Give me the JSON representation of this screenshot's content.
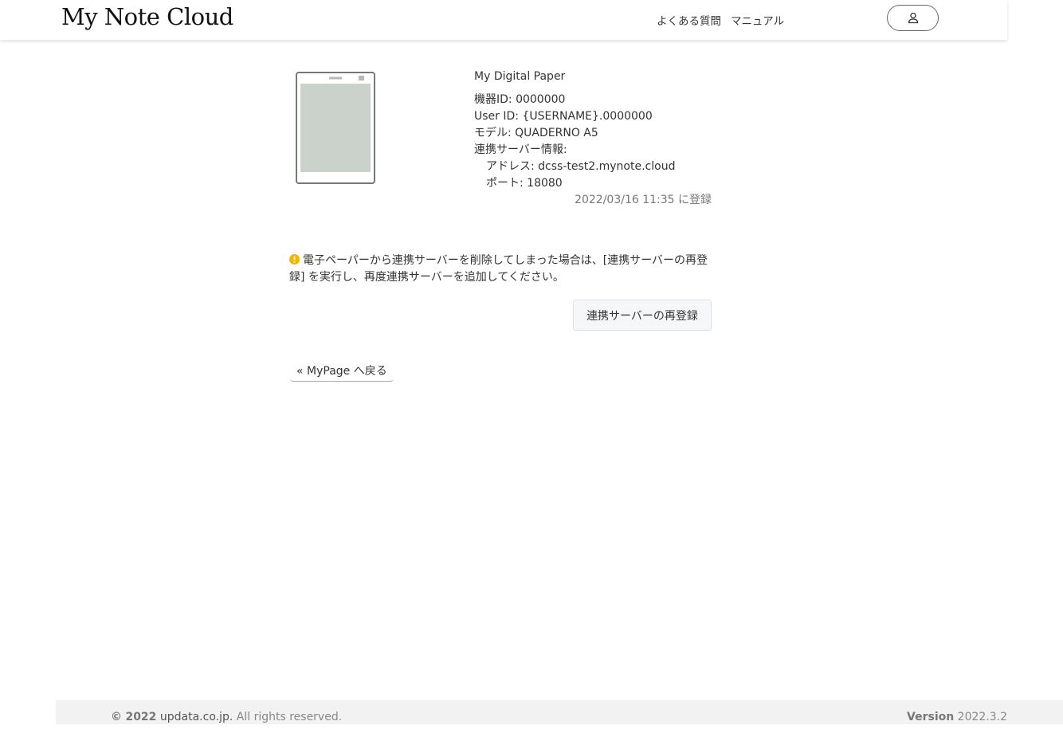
{
  "header": {
    "logo": "My Note Cloud",
    "nav": {
      "faq": "よくある質問",
      "manual": "マニュアル"
    },
    "user_icon": "user-icon"
  },
  "device": {
    "name": "My Digital Paper",
    "device_id": "機器ID: 0000000",
    "user_id": "User ID: {USERNAME}.0000000",
    "model": "モデル: QUADERNO A5",
    "server_info_label": "連携サーバー情報:",
    "address": "アドレス: dcss-test2.mynote.cloud",
    "port": "ポート: 18080",
    "registered": "2022/03/16 11:35 に登録",
    "illustration_icon": "tablet-device-icon",
    "screen_color": "#cbd1cb"
  },
  "notice": {
    "icon": "warning-icon",
    "icon_color": "#f5b400",
    "text": "電子ペーパーから連携サーバーを削除してしまった場合は、[連携サーバーの再登録] を実行し、再度連携サーバーを追加してください。"
  },
  "actions": {
    "reregister_label": "連携サーバーの再登録",
    "back_label": "« MyPage へ戻る"
  },
  "footer": {
    "copyright_symbol": "©",
    "copyright_year": "2022",
    "copyright_domain": "updata.co.jp.",
    "copyright_suffix": "All rights reserved.",
    "version_label": "Version",
    "version_value": "2022.3.2"
  }
}
